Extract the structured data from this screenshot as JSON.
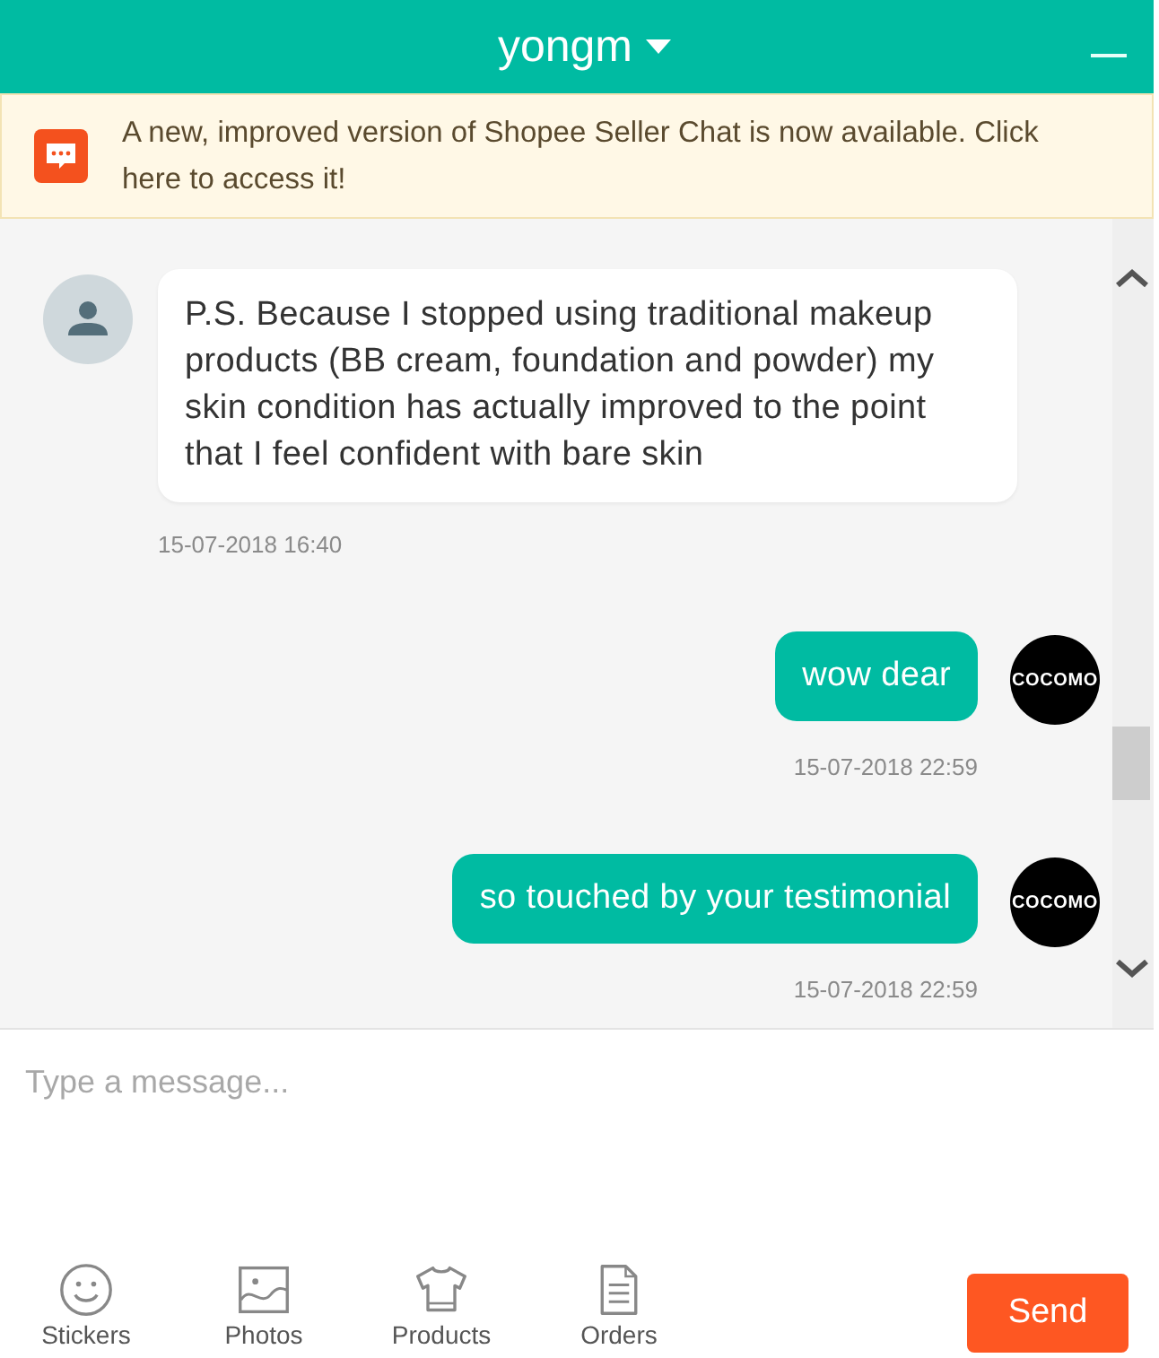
{
  "header": {
    "title": "yongm"
  },
  "banner": {
    "text": "A new, improved version of Shopee Seller Chat is now available. Click here to access it!"
  },
  "messages": [
    {
      "kind": "received",
      "text": "P.S. Because I stopped using traditional makeup products (BB cream, foundation and powder) my skin condition has actually improved to the point that I feel confident with bare skin",
      "time": "15-07-2018 16:40"
    },
    {
      "kind": "sent",
      "text": "wow dear",
      "time": "15-07-2018 22:59",
      "avatar_text": "COCOMO"
    },
    {
      "kind": "sent",
      "text": "so touched by your testimonial",
      "time": "15-07-2018 22:59",
      "avatar_text": "COCOMO"
    }
  ],
  "composer": {
    "placeholder": "Type a message..."
  },
  "tools": [
    {
      "kind": "stickers",
      "label": "Stickers"
    },
    {
      "kind": "photos",
      "label": "Photos"
    },
    {
      "kind": "products",
      "label": "Products"
    },
    {
      "kind": "orders",
      "label": "Orders"
    }
  ],
  "send_button": "Send"
}
